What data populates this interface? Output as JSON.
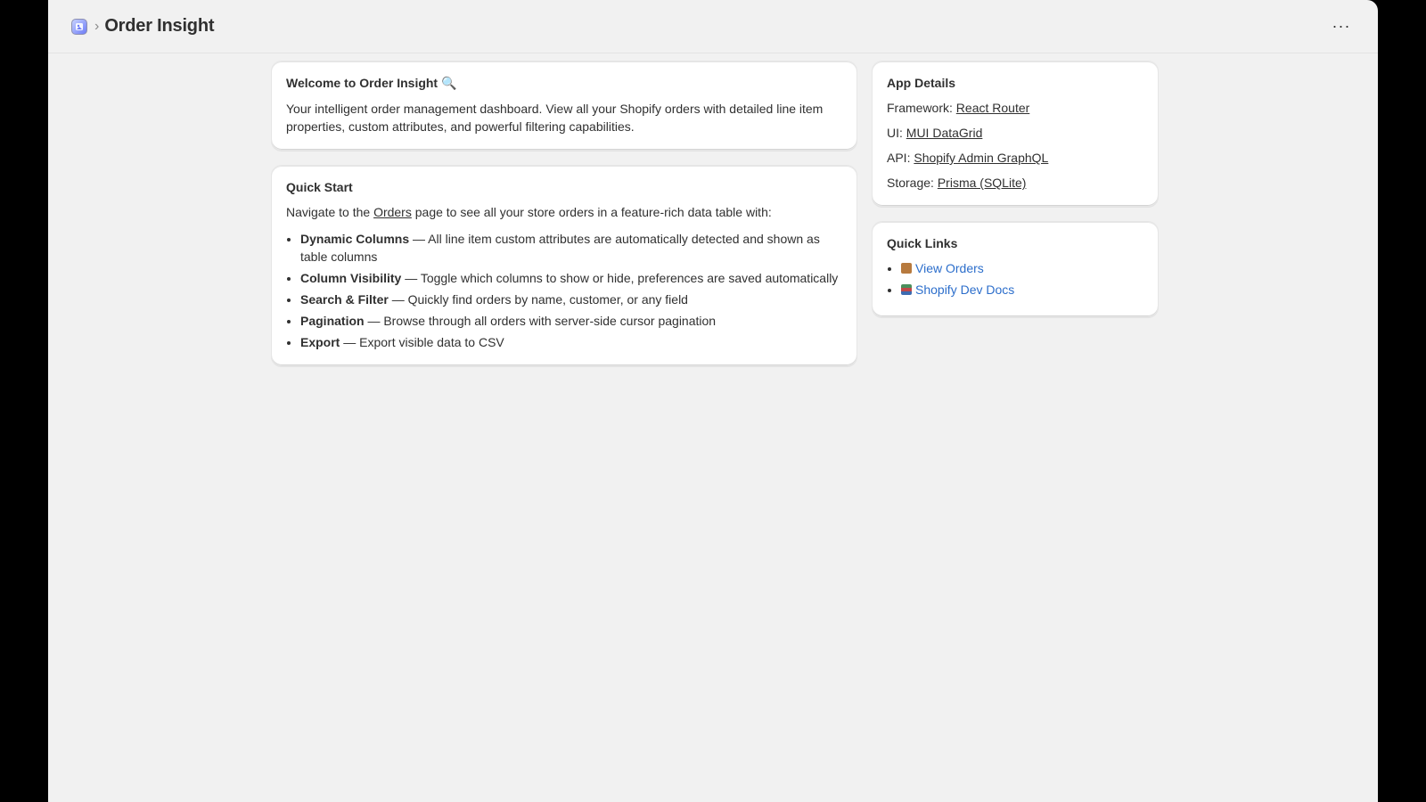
{
  "header": {
    "title": "Order Insight",
    "breadcrumb_separator": "›",
    "menu_label": "···",
    "app_icon": "app-logo-icon"
  },
  "welcome": {
    "heading": "Welcome to Order Insight 🔍",
    "body": "Your intelligent order management dashboard. View all your Shopify orders with detailed line item properties, custom attributes, and powerful filtering capabilities."
  },
  "quick_start": {
    "heading": "Quick Start",
    "intro_before": "Navigate to the ",
    "intro_link": "Orders",
    "intro_after": " page to see all your store orders in a feature-rich data table with:",
    "features": [
      {
        "name": "Dynamic Columns",
        "desc": " — All line item custom attributes are automatically detected and shown as table columns"
      },
      {
        "name": "Column Visibility",
        "desc": " — Toggle which columns to show or hide, preferences are saved automatically"
      },
      {
        "name": "Search & Filter",
        "desc": " — Quickly find orders by name, customer, or any field"
      },
      {
        "name": "Pagination",
        "desc": " — Browse through all orders with server-side cursor pagination"
      },
      {
        "name": "Export",
        "desc": " — Export visible data to CSV"
      }
    ]
  },
  "app_details": {
    "heading": "App Details",
    "rows": [
      {
        "label": "Framework: ",
        "value": "React Router"
      },
      {
        "label": "UI: ",
        "value": "MUI DataGrid"
      },
      {
        "label": "API: ",
        "value": "Shopify Admin GraphQL"
      },
      {
        "label": "Storage: ",
        "value": "Prisma (SQLite)"
      }
    ]
  },
  "quick_links": {
    "heading": "Quick Links",
    "items": [
      {
        "icon": "package-icon",
        "label": "View Orders"
      },
      {
        "icon": "books-icon",
        "label": "Shopify Dev Docs"
      }
    ]
  },
  "colors": {
    "link_blue": "#2c6ecb",
    "page_bg": "#f1f1f1",
    "card_bg": "#ffffff"
  }
}
